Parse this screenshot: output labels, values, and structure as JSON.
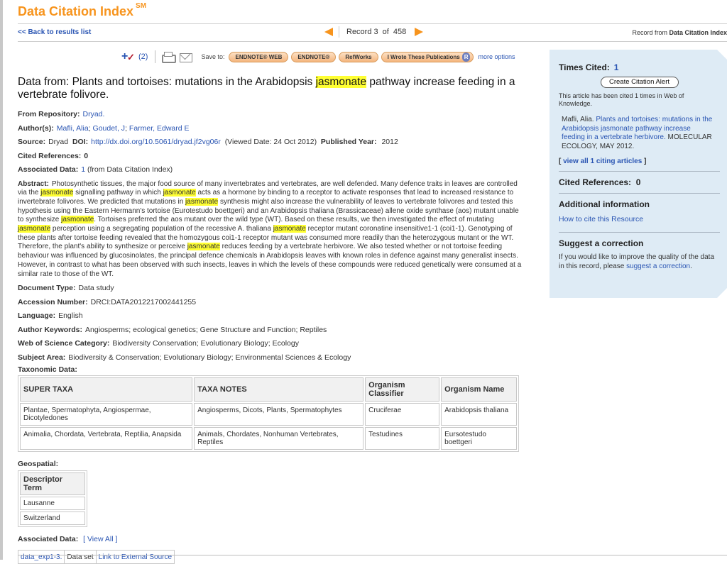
{
  "header": {
    "product_name": "Data Citation Index",
    "product_sup": "SM",
    "back_link": "<< Back to results list",
    "record_label": "Record",
    "record_index": "3",
    "record_of": "of",
    "record_total": "458",
    "record_from_prefix": "Record from",
    "record_from_source": "Data Citation Index",
    "accent_color": "#f7941d"
  },
  "toolbar": {
    "marked_count": "(2)",
    "save_to_label": "Save to:",
    "buttons": [
      "ENDNOTE® WEB",
      "ENDNOTE®",
      "RefWorks",
      "I Wrote These Publications"
    ],
    "rid_badge": "R",
    "more_options": "more options"
  },
  "record": {
    "title_before": "Data from: Plants and tortoises: mutations in the Arabidopsis",
    "title_highlight": "jasmonate",
    "title_after": "pathway increase feeding in a vertebrate folivore.",
    "repository_label": "From Repository:",
    "repository_value": "Dryad.",
    "authors_label": "Author(s):",
    "authors": [
      "Mafli, Alia",
      "Goudet, J",
      "Farmer, Edward E"
    ],
    "source_label": "Source:",
    "source_value": "Dryad",
    "doi_label": "DOI:",
    "doi_value": "http://dx.doi.org/10.5061/dryad.jf2vg06r",
    "viewed_date": "(Viewed Date: 24 Oct 2012)",
    "pub_year_label": "Published Year:",
    "pub_year_value": "2012",
    "cited_refs_label": "Cited References:",
    "cited_refs_value": "0",
    "assoc_data_label": "Associated Data:",
    "assoc_data_count": "1",
    "assoc_data_source": "(from Data Citation Index)",
    "abstract_label": "Abstract:",
    "abstract_segments": [
      {
        "t": "Photosynthetic tissues, the major food source of many invertebrates and vertebrates, are well defended. Many defence traits in leaves are controlled via the "
      },
      {
        "t": "jasmonate",
        "hl": true
      },
      {
        "t": " signalling pathway in which "
      },
      {
        "t": "jasmonate",
        "hl": true
      },
      {
        "t": " acts as a hormone by binding to a receptor to activate responses that lead to increased resistance to invertebrate folivores. We predicted that mutations in "
      },
      {
        "t": "jasmonate",
        "hl": true
      },
      {
        "t": " synthesis might also increase the vulnerability of leaves to vertebrate folivores and tested this hypothesis using the Eastern Hermann's tortoise (Eurotestudo boettgeri) and an Arabidopsis thaliana (Brassicaceae) allene oxide synthase (aos) mutant unable to synthesize "
      },
      {
        "t": "jasmonate",
        "hl": true
      },
      {
        "t": ". Tortoises preferred the aos mutant over the wild type (WT). Based on these results, we then investigated the effect of mutating "
      },
      {
        "t": "jasmonate",
        "hl": true
      },
      {
        "t": " perception using a segregating population of the recessive A. thaliana "
      },
      {
        "t": "jasmonate",
        "hl": true
      },
      {
        "t": " receptor mutant coronatine insensitive1-1 (coi1-1). Genotyping of these plants after tortoise feeding revealed that the homozygous coi1-1 receptor mutant was consumed more readily than the heterozygous mutant or the WT. Therefore, the plant's ability to synthesize or perceive "
      },
      {
        "t": "jasmonate",
        "hl": true
      },
      {
        "t": " reduces feeding by a vertebrate herbivore. We also tested whether or not tortoise feeding behaviour was influenced by glucosinolates, the principal defence chemicals in Arabidopsis leaves with known roles in defence against many generalist insects. However, in contrast to what has been observed with such insects, leaves in which the levels of these compounds were reduced genetically were consumed at a similar rate to those of the WT."
      }
    ],
    "doc_type_label": "Document Type:",
    "doc_type_value": "Data study",
    "accession_label": "Accession Number:",
    "accession_value": "DRCI:DATA2012217002441255",
    "language_label": "Language:",
    "language_value": "English",
    "keywords_label": "Author Keywords:",
    "keywords_value": "Angiosperms; ecological genetics; Gene Structure and Function; Reptiles",
    "wos_category_label": "Web of Science Category:",
    "wos_category_value": "Biodiversity Conservation; Evolutionary Biology; Ecology",
    "subject_label": "Subject Area:",
    "subject_value": "Biodiversity & Conservation; Evolutionary Biology; Environmental Sciences & Ecology",
    "taxonomic_label": "Taxonomic Data:",
    "taxonomic_headers": [
      "SUPER TAXA",
      "TAXA NOTES",
      "Organism Classifier",
      "Organism Name"
    ],
    "taxonomic_rows": [
      [
        "Plantae, Spermatophyta, Angiospermae, Dicotyledones",
        "Angiosperms, Dicots, Plants, Spermatophytes",
        "Cruciferae",
        "Arabidopsis thaliana"
      ],
      [
        "Animalia, Chordata, Vertebrata, Reptilia, Anapsida",
        "Animals, Chordates, Nonhuman Vertebrates, Reptiles",
        "Testudines",
        "Eursotestudo boettgeri"
      ]
    ],
    "geospatial_label": "Geospatial:",
    "geospatial_header": "Descriptor Term",
    "geospatial_rows": [
      "Lausanne",
      "Switzerland"
    ],
    "assoc_data2_label": "Associated Data:",
    "assoc_data2_view_all": "[ View All ]",
    "assoc_row": [
      "data_exp1-3.",
      "Data set",
      "Link to External Source"
    ]
  },
  "sidebar": {
    "times_cited_label": "Times Cited:",
    "times_cited_value": "1",
    "alert_button": "Create Citation Alert",
    "cited_note": "This article has been cited 1 times in Web of Knowledge.",
    "citing_author": "Mafli, Alia.",
    "citing_title": "Plants and tortoises: mutations in the Arabidopsis jasmonate pathway increase feeding in a vertebrate herbivore.",
    "citing_journal": "MOLECULAR ECOLOGY, MAY 2012.",
    "view_all_open": "[",
    "view_all_link": "view all 1 citing articles",
    "view_all_close": "]",
    "cited_refs_label": "Cited References:",
    "cited_refs_value": "0",
    "additional_label": "Additional information",
    "how_to_cite": "How to cite this Resource",
    "suggest_label": "Suggest a correction",
    "suggest_text": "If you would like to improve the quality of the data in this record, please",
    "suggest_link": "suggest a correction",
    "suggest_end": ".",
    "panel_color": "#deebf5"
  }
}
